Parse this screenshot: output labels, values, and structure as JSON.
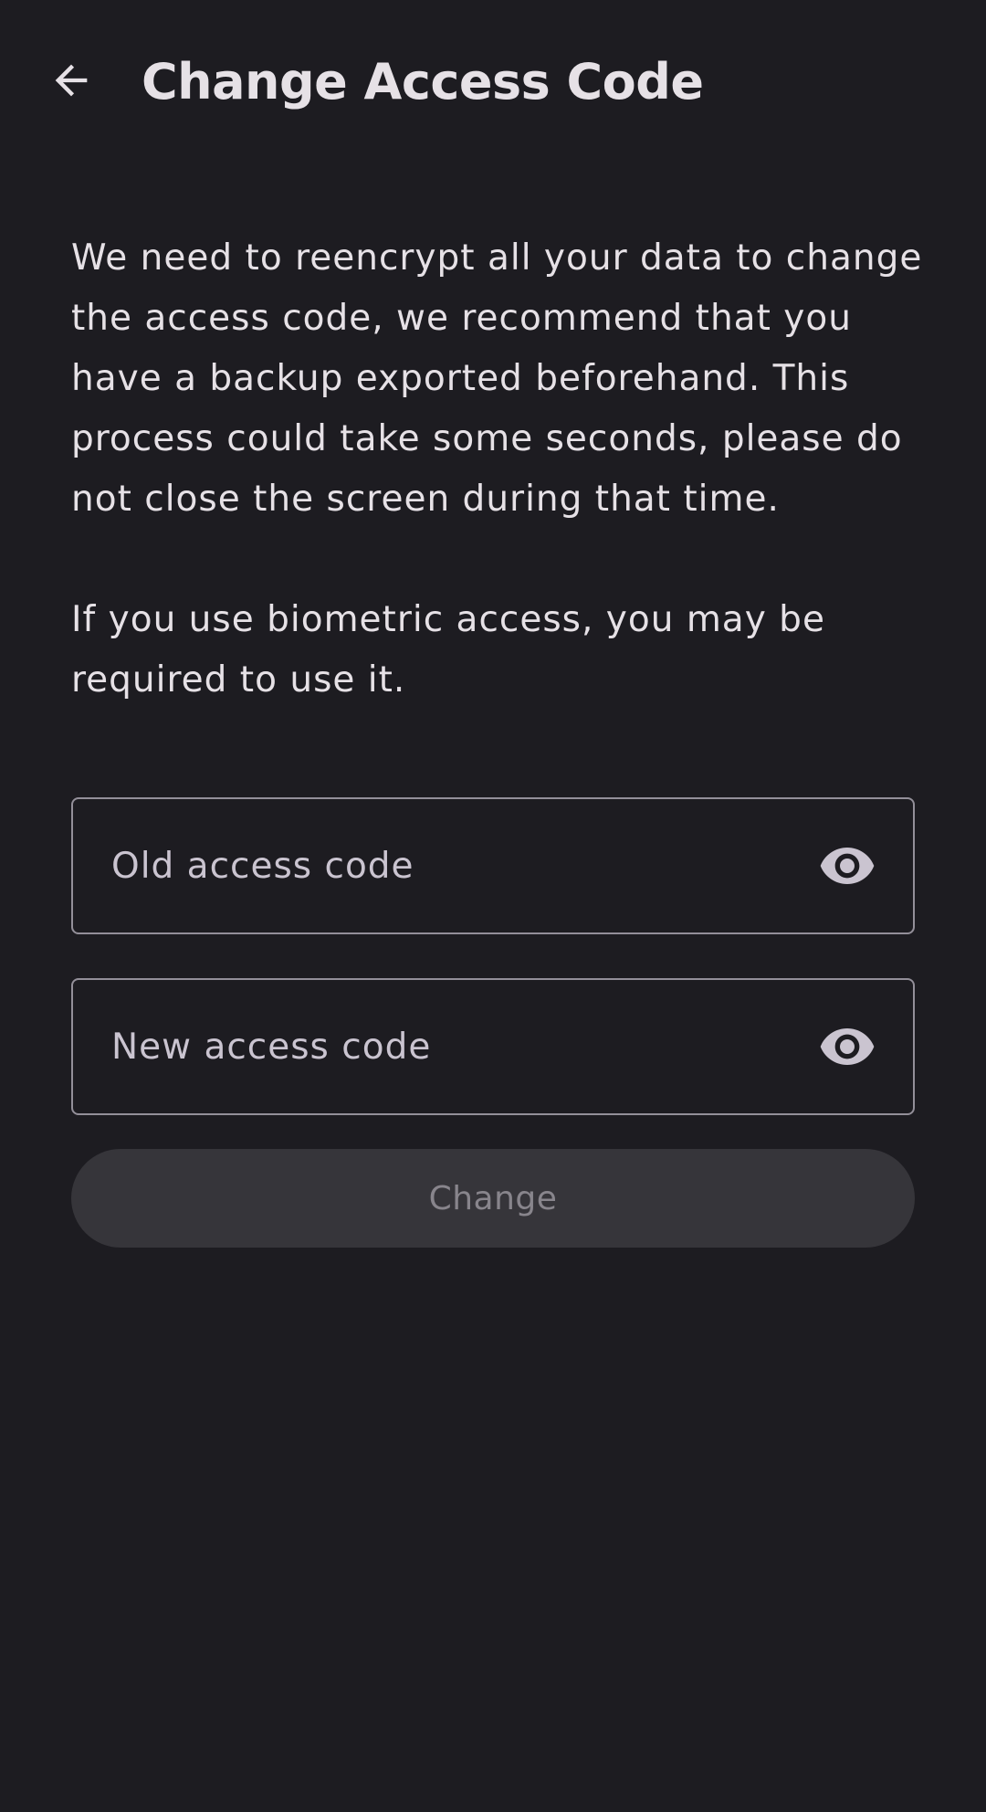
{
  "app_bar": {
    "title": "Change Access Code",
    "back_icon": "arrow-back-icon"
  },
  "description": {
    "paragraph_1": "We need to reencrypt all your data to change the access code, we recommend that you have a backup exported beforehand. This process could take some seconds, please do not close the screen during that time.",
    "paragraph_2": "If you use biometric access, you may be required to use it."
  },
  "form": {
    "old_code": {
      "placeholder": "Old access code",
      "value": "",
      "toggle_icon": "eye-icon"
    },
    "new_code": {
      "placeholder": "New access code",
      "value": "",
      "toggle_icon": "eye-icon"
    },
    "submit_label": "Change",
    "submit_enabled": false
  },
  "colors": {
    "background": "#1d1c21",
    "text": "#e6e1e6",
    "outline": "#938f99",
    "disabled_button_bg": "#36353a",
    "disabled_button_text": "#88858c"
  }
}
